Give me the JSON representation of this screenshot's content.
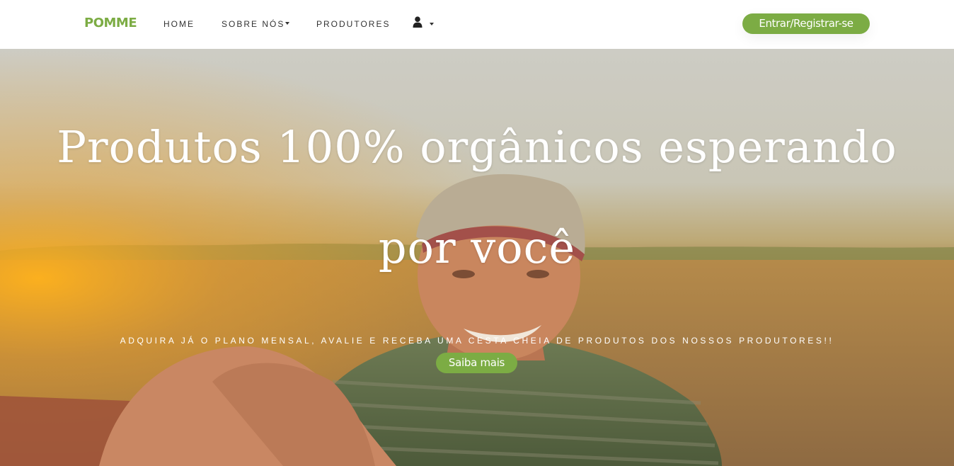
{
  "nav": {
    "brand": "POMME",
    "items": [
      {
        "label": "HOME"
      },
      {
        "label": "SOBRE NÓS",
        "has_dropdown": true
      },
      {
        "label": "PRODUTORES"
      }
    ],
    "user_icon": "user-icon",
    "login_label": "Entrar/Registrar-se"
  },
  "hero": {
    "title": "Produtos 100% orgânicos esperando por você",
    "subtitle": "Adquira já o plano mensal, avalie e receba uma cesta cheia de produtos dos nossos produtores!!",
    "cta_label": "Saiba mais"
  },
  "colors": {
    "accent": "#7cac44",
    "nav_text": "#333333",
    "hero_text": "#ffffff"
  }
}
